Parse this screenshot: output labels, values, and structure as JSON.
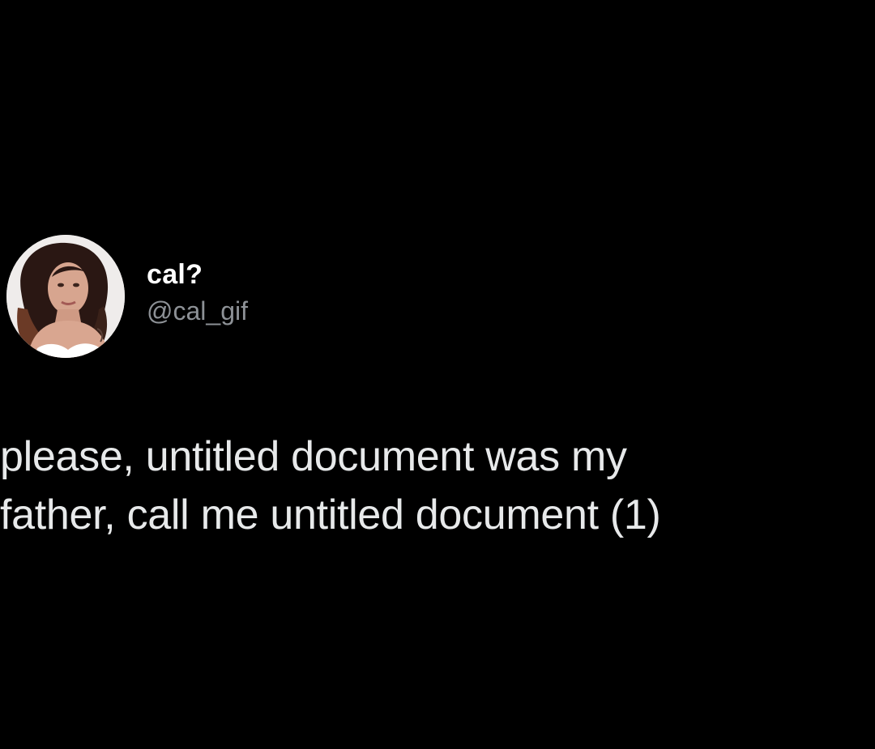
{
  "tweet": {
    "author": {
      "display_name": "cal?",
      "handle": "@cal_gif",
      "avatar": "profile-photo"
    },
    "text_lines": [
      "please, untitled document was my",
      "father, call me untitled document (1)"
    ]
  },
  "colors": {
    "background": "#000000",
    "display_name": "#ffffff",
    "handle": "#8d9196",
    "body_text": "#e7e9ea"
  }
}
